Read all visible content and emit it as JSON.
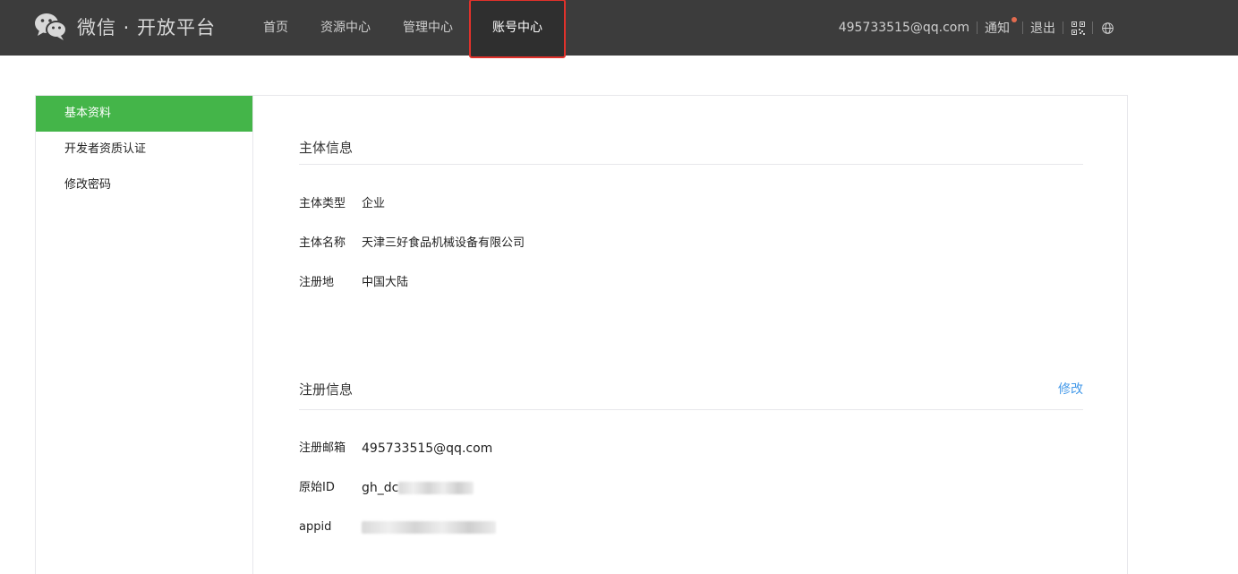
{
  "header": {
    "logo_text": "微信 · 开放平台",
    "nav": [
      {
        "label": "首页"
      },
      {
        "label": "资源中心"
      },
      {
        "label": "管理中心"
      },
      {
        "label": "账号中心"
      }
    ],
    "account_email": "495733515@qq.com",
    "notice_label": "通知",
    "logout_label": "退出"
  },
  "sidebar": {
    "items": [
      {
        "label": "基本资料"
      },
      {
        "label": "开发者资质认证"
      },
      {
        "label": "修改密码"
      }
    ]
  },
  "subject_info": {
    "title": "主体信息",
    "type_label": "主体类型",
    "type_value": "企业",
    "name_label": "主体名称",
    "name_value": "天津三好食品机械设备有限公司",
    "region_label": "注册地",
    "region_value": "中国大陆"
  },
  "register_info": {
    "title": "注册信息",
    "edit_label": "修改",
    "email_label": "注册邮箱",
    "email_value": "495733515@qq.com",
    "id_label": "原始ID",
    "id_value": "gh_dc",
    "appid_label": "appid"
  },
  "colors": {
    "topbar": "#3c3c3c",
    "accent_green": "#44b549",
    "link_blue": "#459ae9",
    "highlight_red": "#e0312b",
    "notice_dot": "#e36b4f"
  }
}
